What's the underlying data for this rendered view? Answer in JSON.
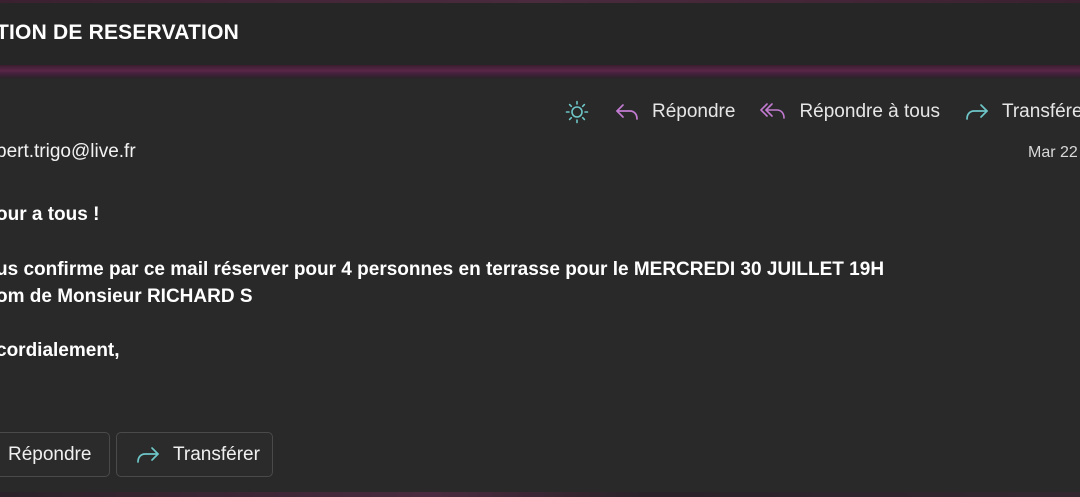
{
  "header": {
    "subject": "TION DE RESERVATION"
  },
  "toolbar": {
    "brightness_icon": "sun-icon",
    "reply_label": "Répondre",
    "reply_all_label": "Répondre à tous",
    "forward_label": "Transférer",
    "forward_visible_label": "Transfére"
  },
  "message": {
    "sender": "bert.trigo@live.fr",
    "date": "Mar 22",
    "body": {
      "greeting": "our a tous !",
      "line_1": "us confirme par ce mail réserver pour 4 personnes en terrasse pour le MERCREDI 30 JUILLET 19H",
      "line_2": "om de Monsieur RICHARD S",
      "closing": "cordialement,"
    }
  },
  "actions": {
    "reply_label": "Répondre",
    "forward_label": "Transférer"
  },
  "colors": {
    "background": "#292929",
    "header": "#262626",
    "accent_band": "#5a2748",
    "icon_purple": "#c27bd1",
    "icon_teal": "#6ec6c8",
    "button_border": "#4a4a4a"
  }
}
